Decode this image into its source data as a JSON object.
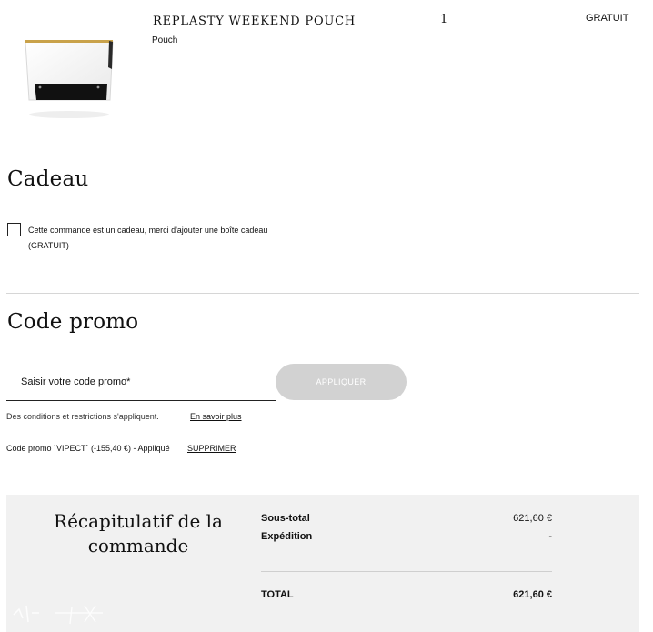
{
  "product": {
    "name": "REPLASTY WEEKEND POUCH",
    "type": "Pouch",
    "quantity": "1",
    "price": "GRATUIT",
    "image_icon": "white-pouch-image"
  },
  "gift": {
    "heading": "Cadeau",
    "checkbox_label_line1": "Cette commande est un cadeau, merci d'ajouter une boîte cadeau",
    "checkbox_label_line2": "(GRATUIT)",
    "checked": false
  },
  "promo": {
    "heading": "Code promo",
    "input_placeholder": "Saisir votre code promo*",
    "input_value": "",
    "apply_label": "APPLIQUER",
    "conditions_text": "Des conditions et restrictions s'appliquent.",
    "learn_more_label": "En savoir plus",
    "applied_text": "Code promo `VIPECT` (-155,40 €) - Appliqué",
    "remove_label": "SUPPRIMER"
  },
  "summary": {
    "title_line1": "Récapitulatif de la",
    "title_line2": "commande",
    "subtotal_label": "Sous-total",
    "subtotal_value": "621,60 €",
    "shipping_label": "Expédition",
    "shipping_value": "-",
    "total_label": "TOTAL",
    "total_value": "621,60 €"
  },
  "colors": {
    "apply_button_bg": "#d2d2d2",
    "summary_bg": "#f1f1f1",
    "text": "#111111"
  }
}
